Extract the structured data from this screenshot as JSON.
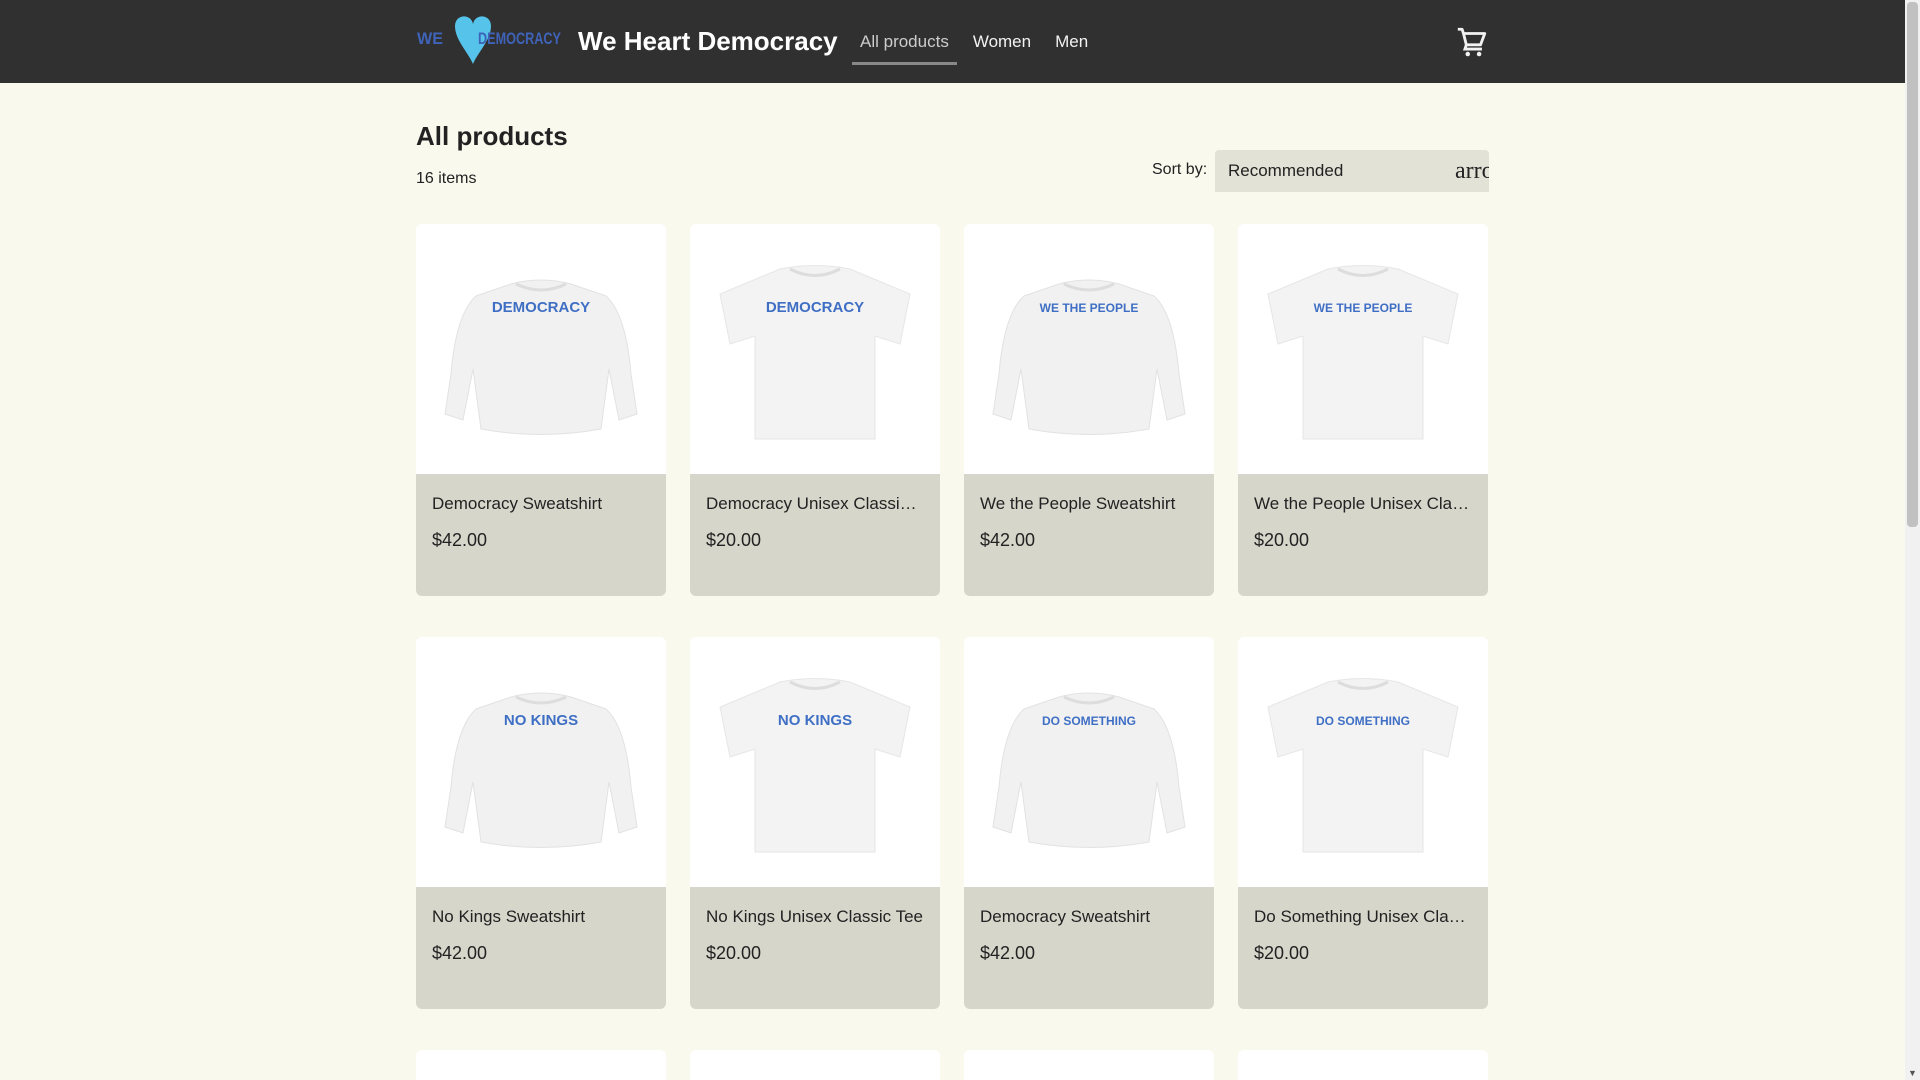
{
  "header": {
    "brand": "We Heart Democracy",
    "logo_text_left": "WE",
    "logo_text_right": "DEMOCRACY",
    "nav": [
      {
        "label": "All products",
        "active": true
      },
      {
        "label": "Women"
      },
      {
        "label": "Men"
      }
    ],
    "cart_icon": "shopping-cart-icon"
  },
  "main": {
    "title": "All products",
    "count": "16 items",
    "sort_label": "Sort by:",
    "sort_value": "Recommended",
    "sort_icon_text": "arrow_drop_down",
    "products": [
      {
        "name": "Democracy Sweatshirt",
        "price": "$42.00",
        "type": "sweatshirt",
        "print": "DEMOCRACY"
      },
      {
        "name": "Democracy Unisex Classic Tee",
        "price": "$20.00",
        "type": "tee",
        "print": "DEMOCRACY"
      },
      {
        "name": "We the People Sweatshirt",
        "price": "$42.00",
        "type": "sweatshirt",
        "print": "WE THE PEOPLE"
      },
      {
        "name": "We the People Unisex Classic Tee",
        "price": "$20.00",
        "type": "tee",
        "print": "WE THE PEOPLE"
      },
      {
        "name": "No Kings Sweatshirt",
        "price": "$42.00",
        "type": "sweatshirt",
        "print": "NO KINGS"
      },
      {
        "name": "No Kings Unisex Classic Tee",
        "price": "$20.00",
        "type": "tee",
        "print": "NO KINGS"
      },
      {
        "name": "Democracy Sweatshirt",
        "price": "$42.00",
        "type": "sweatshirt",
        "print": "DO SOMETHING"
      },
      {
        "name": "Do Something Unisex Classic Tee",
        "price": "$20.00",
        "type": "tee",
        "print": "DO SOMETHING"
      }
    ]
  },
  "colors": {
    "header": "#303030",
    "background": "#f9f9ee",
    "card_info": "#d6d6cb",
    "print": "#3f6fc4",
    "logo_heart": "#55c3ea"
  }
}
